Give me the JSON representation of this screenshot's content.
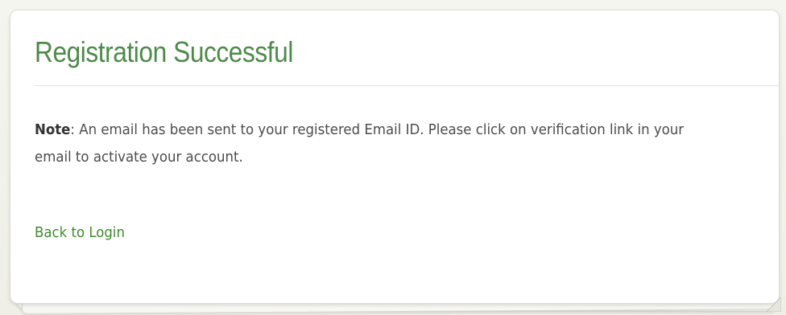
{
  "colors": {
    "title": "#4e8a4a",
    "link": "#3f8a2f",
    "body_text": "#4c4c4c",
    "card_bg": "#ffffff",
    "page_bg": "#f2f2ec"
  },
  "card": {
    "title": "Registration Successful",
    "note_label": "Note",
    "note_separator": ":",
    "note_text": " An email has been sent to your registered Email ID. Please click on verification link in your email to activate your account.",
    "back_link": "Back to Login"
  },
  "icons": {
    "corner": "page-curl-icon"
  }
}
